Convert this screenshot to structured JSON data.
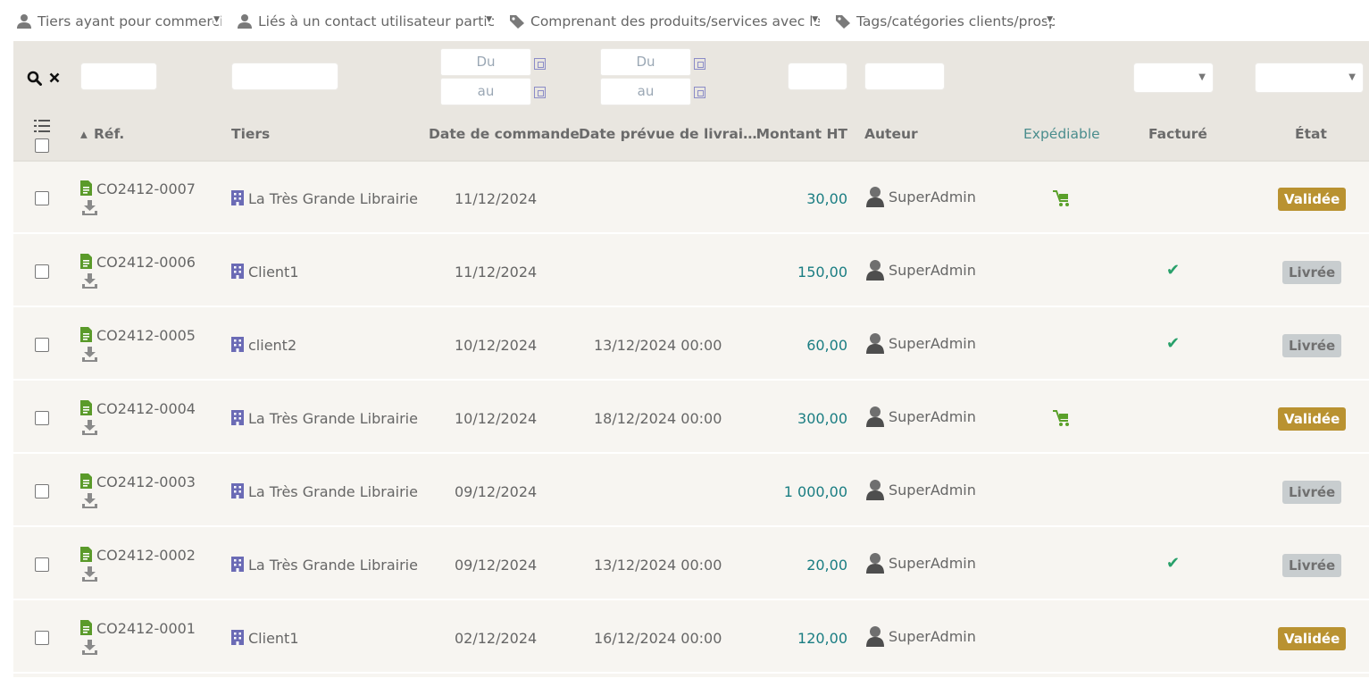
{
  "top_filters": [
    {
      "icon": "user-icon",
      "label": "Tiers ayant pour commercial"
    },
    {
      "icon": "user-icon",
      "label": "Liés à un contact utilisateur particulier"
    },
    {
      "icon": "tag-icon",
      "label": "Comprenant des produits/services avec le tag"
    },
    {
      "icon": "tag-icon",
      "label": "Tags/catégories clients/prospects"
    }
  ],
  "filters": {
    "date_order_from_placeholder": "Du",
    "date_order_to_placeholder": "au",
    "date_delivery_from_placeholder": "Du",
    "date_delivery_to_placeholder": "au"
  },
  "columns": {
    "ref": "Réf.",
    "tiers": "Tiers",
    "date_commande": "Date de commande",
    "date_livraison": "Date prévue de livrai…",
    "montant": "Montant HT",
    "auteur": "Auteur",
    "expediable": "Expédiable",
    "facture": "Facturé",
    "etat": "État"
  },
  "rows": [
    {
      "ref": "CO2412-0007",
      "tiers": "La Très Grande Librairie",
      "date_commande": "11/12/2024",
      "date_livraison": "",
      "montant": "30,00",
      "auteur": "SuperAdmin",
      "expediable": true,
      "facture": false,
      "etat": "Validée"
    },
    {
      "ref": "CO2412-0006",
      "tiers": "Client1",
      "date_commande": "11/12/2024",
      "date_livraison": "",
      "montant": "150,00",
      "auteur": "SuperAdmin",
      "expediable": false,
      "facture": true,
      "etat": "Livrée"
    },
    {
      "ref": "CO2412-0005",
      "tiers": "client2",
      "date_commande": "10/12/2024",
      "date_livraison": "13/12/2024 00:00",
      "montant": "60,00",
      "auteur": "SuperAdmin",
      "expediable": false,
      "facture": true,
      "etat": "Livrée"
    },
    {
      "ref": "CO2412-0004",
      "tiers": "La Très Grande Librairie",
      "date_commande": "10/12/2024",
      "date_livraison": "18/12/2024 00:00",
      "montant": "300,00",
      "auteur": "SuperAdmin",
      "expediable": true,
      "facture": false,
      "etat": "Validée"
    },
    {
      "ref": "CO2412-0003",
      "tiers": "La Très Grande Librairie",
      "date_commande": "09/12/2024",
      "date_livraison": "",
      "montant": "1 000,00",
      "auteur": "SuperAdmin",
      "expediable": false,
      "facture": false,
      "etat": "Livrée"
    },
    {
      "ref": "CO2412-0002",
      "tiers": "La Très Grande Librairie",
      "date_commande": "09/12/2024",
      "date_livraison": "13/12/2024 00:00",
      "montant": "20,00",
      "auteur": "SuperAdmin",
      "expediable": false,
      "facture": true,
      "etat": "Livrée"
    },
    {
      "ref": "CO2412-0001",
      "tiers": "Client1",
      "date_commande": "02/12/2024",
      "date_livraison": "16/12/2024 00:00",
      "montant": "120,00",
      "auteur": "SuperAdmin",
      "expediable": false,
      "facture": false,
      "etat": "Validée"
    }
  ],
  "colors": {
    "validee": "#b99231",
    "livree": "#c8cdcf",
    "amount": "#1a7d82",
    "doc_icon": "#5a9a2a",
    "building_icon": "#6b6bb5",
    "check": "#28a06a"
  }
}
